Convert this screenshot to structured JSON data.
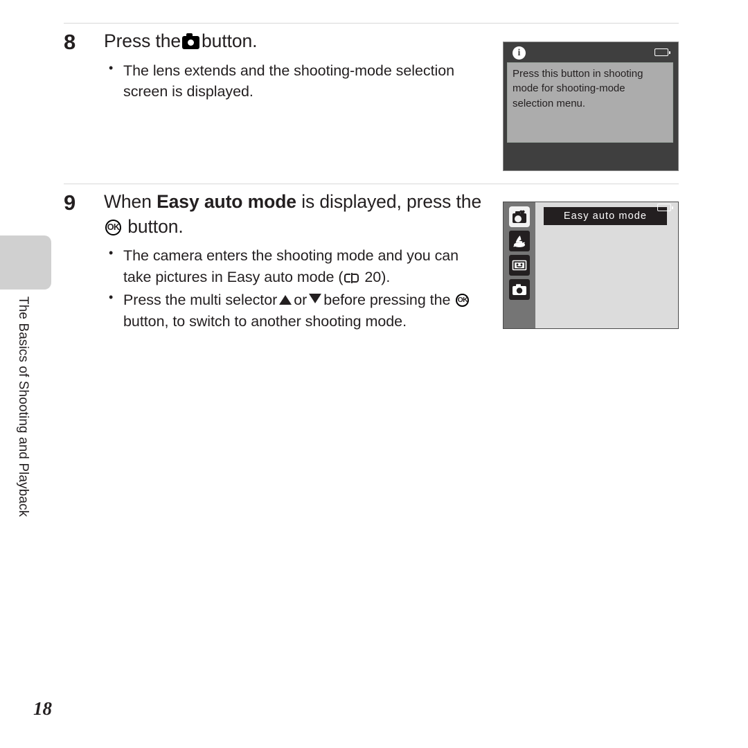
{
  "chapter": {
    "label": "The Basics of Shooting and Playback"
  },
  "page_number": "18",
  "steps": [
    {
      "number": "8",
      "heading_before": "Press the",
      "heading_icon": "camera-icon",
      "heading_after": "button.",
      "bullets": [
        "The lens extends and the shooting-mode selection screen is displayed."
      ]
    },
    {
      "number": "9",
      "heading_before": "When",
      "heading_bold": "Easy auto mode",
      "heading_mid": "is displayed, press the",
      "heading_icon": "ok-button-icon",
      "heading_after": "button.",
      "bullets": [
        {
          "part1": "The camera enters the shooting mode and you can take pictures in Easy auto mode (",
          "ref_icon": "book-icon",
          "ref_page": "20",
          "part2": ")."
        },
        {
          "part1": "Press the multi selector",
          "icon1": "triangle-up-icon",
          "mid": "or",
          "icon2": "triangle-down-icon",
          "part2": "before pressing the",
          "icon3": "ok-button-icon",
          "part3": "button, to switch to another shooting mode."
        }
      ]
    }
  ],
  "screen1": {
    "name": "info-message-screen",
    "info_icon": "info-icon",
    "battery_icon": "battery-icon",
    "message": "Press this button in shooting mode for shooting-mode selection menu.",
    "colors": {
      "bar": "#3f3f3f",
      "panel": "#acacac"
    }
  },
  "screen2": {
    "name": "shooting-mode-selection-screen",
    "selected_mode_label": "Easy auto mode",
    "battery_icon": "battery-icon",
    "modes": [
      {
        "name": "easy-auto-mode-icon",
        "selected": true
      },
      {
        "name": "scene-mode-icon",
        "selected": false
      },
      {
        "name": "smart-portrait-mode-icon",
        "selected": false
      },
      {
        "name": "auto-mode-icon",
        "selected": false
      }
    ],
    "colors": {
      "sidebar": "#757575",
      "background": "#dcdcdc",
      "label_bar": "#231f20"
    }
  }
}
